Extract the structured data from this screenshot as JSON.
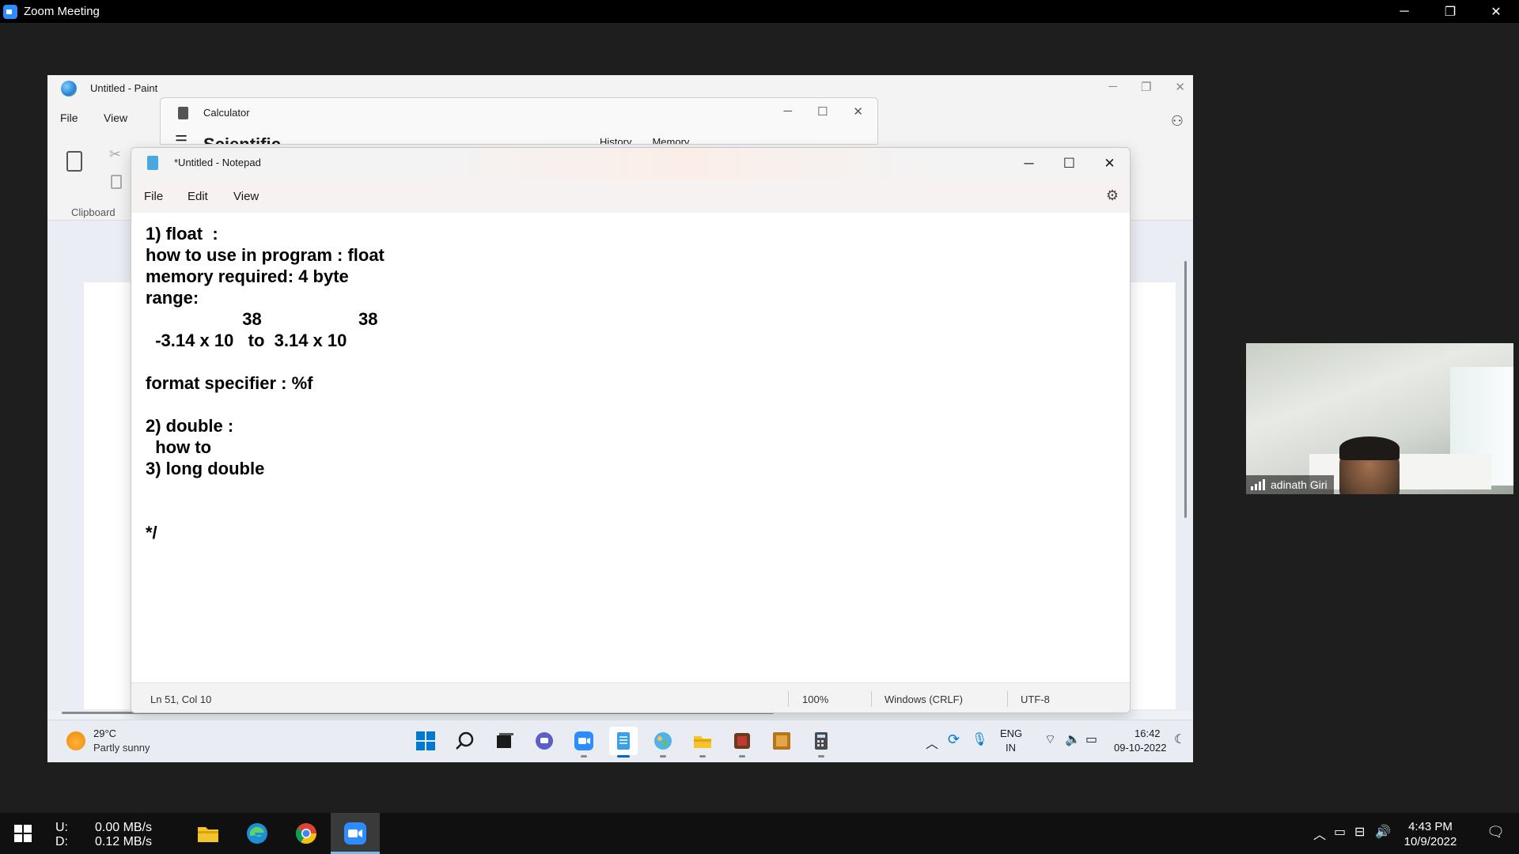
{
  "zoom": {
    "title": "Zoom Meeting",
    "window_controls": [
      "─",
      "❐",
      "✕"
    ]
  },
  "paint": {
    "title": "Untitled - Paint",
    "menu": {
      "file": "File",
      "view": "View"
    },
    "ribbon": {
      "clipboard_label": "Clipboard"
    },
    "controls": [
      "─",
      "❐",
      "✕"
    ]
  },
  "calculator": {
    "title": "Calculator",
    "mode": "Scientific",
    "tabs": {
      "history": "History",
      "memory": "Memory"
    },
    "controls": [
      "─",
      "☐",
      "✕"
    ]
  },
  "notepad": {
    "title": "*Untitled - Notepad",
    "menu": {
      "file": "File",
      "edit": "Edit",
      "view": "View"
    },
    "controls": [
      "─",
      "☐",
      "✕"
    ],
    "lines": [
      "1) float  :",
      "how to use in program : float",
      "memory required: 4 byte",
      "range:",
      "                    38                    38",
      "  -3.14 x 10   to  3.14 x 10",
      "",
      "format specifier : %f",
      "",
      "2) double :",
      "  how to",
      "3) long double",
      "",
      "",
      "*/"
    ],
    "status": {
      "position": "Ln 51, Col 10",
      "zoom": "100%",
      "line_ending": "Windows (CRLF)",
      "encoding": "UTF-8"
    }
  },
  "inner_taskbar": {
    "weather": {
      "temp": "29°C",
      "condition": "Partly sunny"
    },
    "apps": [
      "start-icon",
      "search-icon",
      "task-view-icon",
      "teams-chat-icon",
      "zoom-icon",
      "notepad-icon",
      "paint-icon",
      "file-explorer-icon",
      "app-icon-1",
      "app-icon-2",
      "calculator-icon"
    ],
    "active_app": "notepad-icon",
    "tray": {
      "lang": "ENG",
      "region": "IN",
      "time": "16:42",
      "date": "09-10-2022"
    }
  },
  "participant": {
    "name": "adinath Giri"
  },
  "host_taskbar": {
    "net_upload_label": "U:",
    "net_upload": "0.00 MB/s",
    "net_download_label": "D:",
    "net_download": "0.12 MB/s",
    "pinned": [
      "file-explorer-icon",
      "edge-icon",
      "chrome-icon",
      "zoom-icon"
    ],
    "active_pin": "zoom-icon",
    "clock_time": "4:43 PM",
    "clock_date": "10/9/2022"
  }
}
